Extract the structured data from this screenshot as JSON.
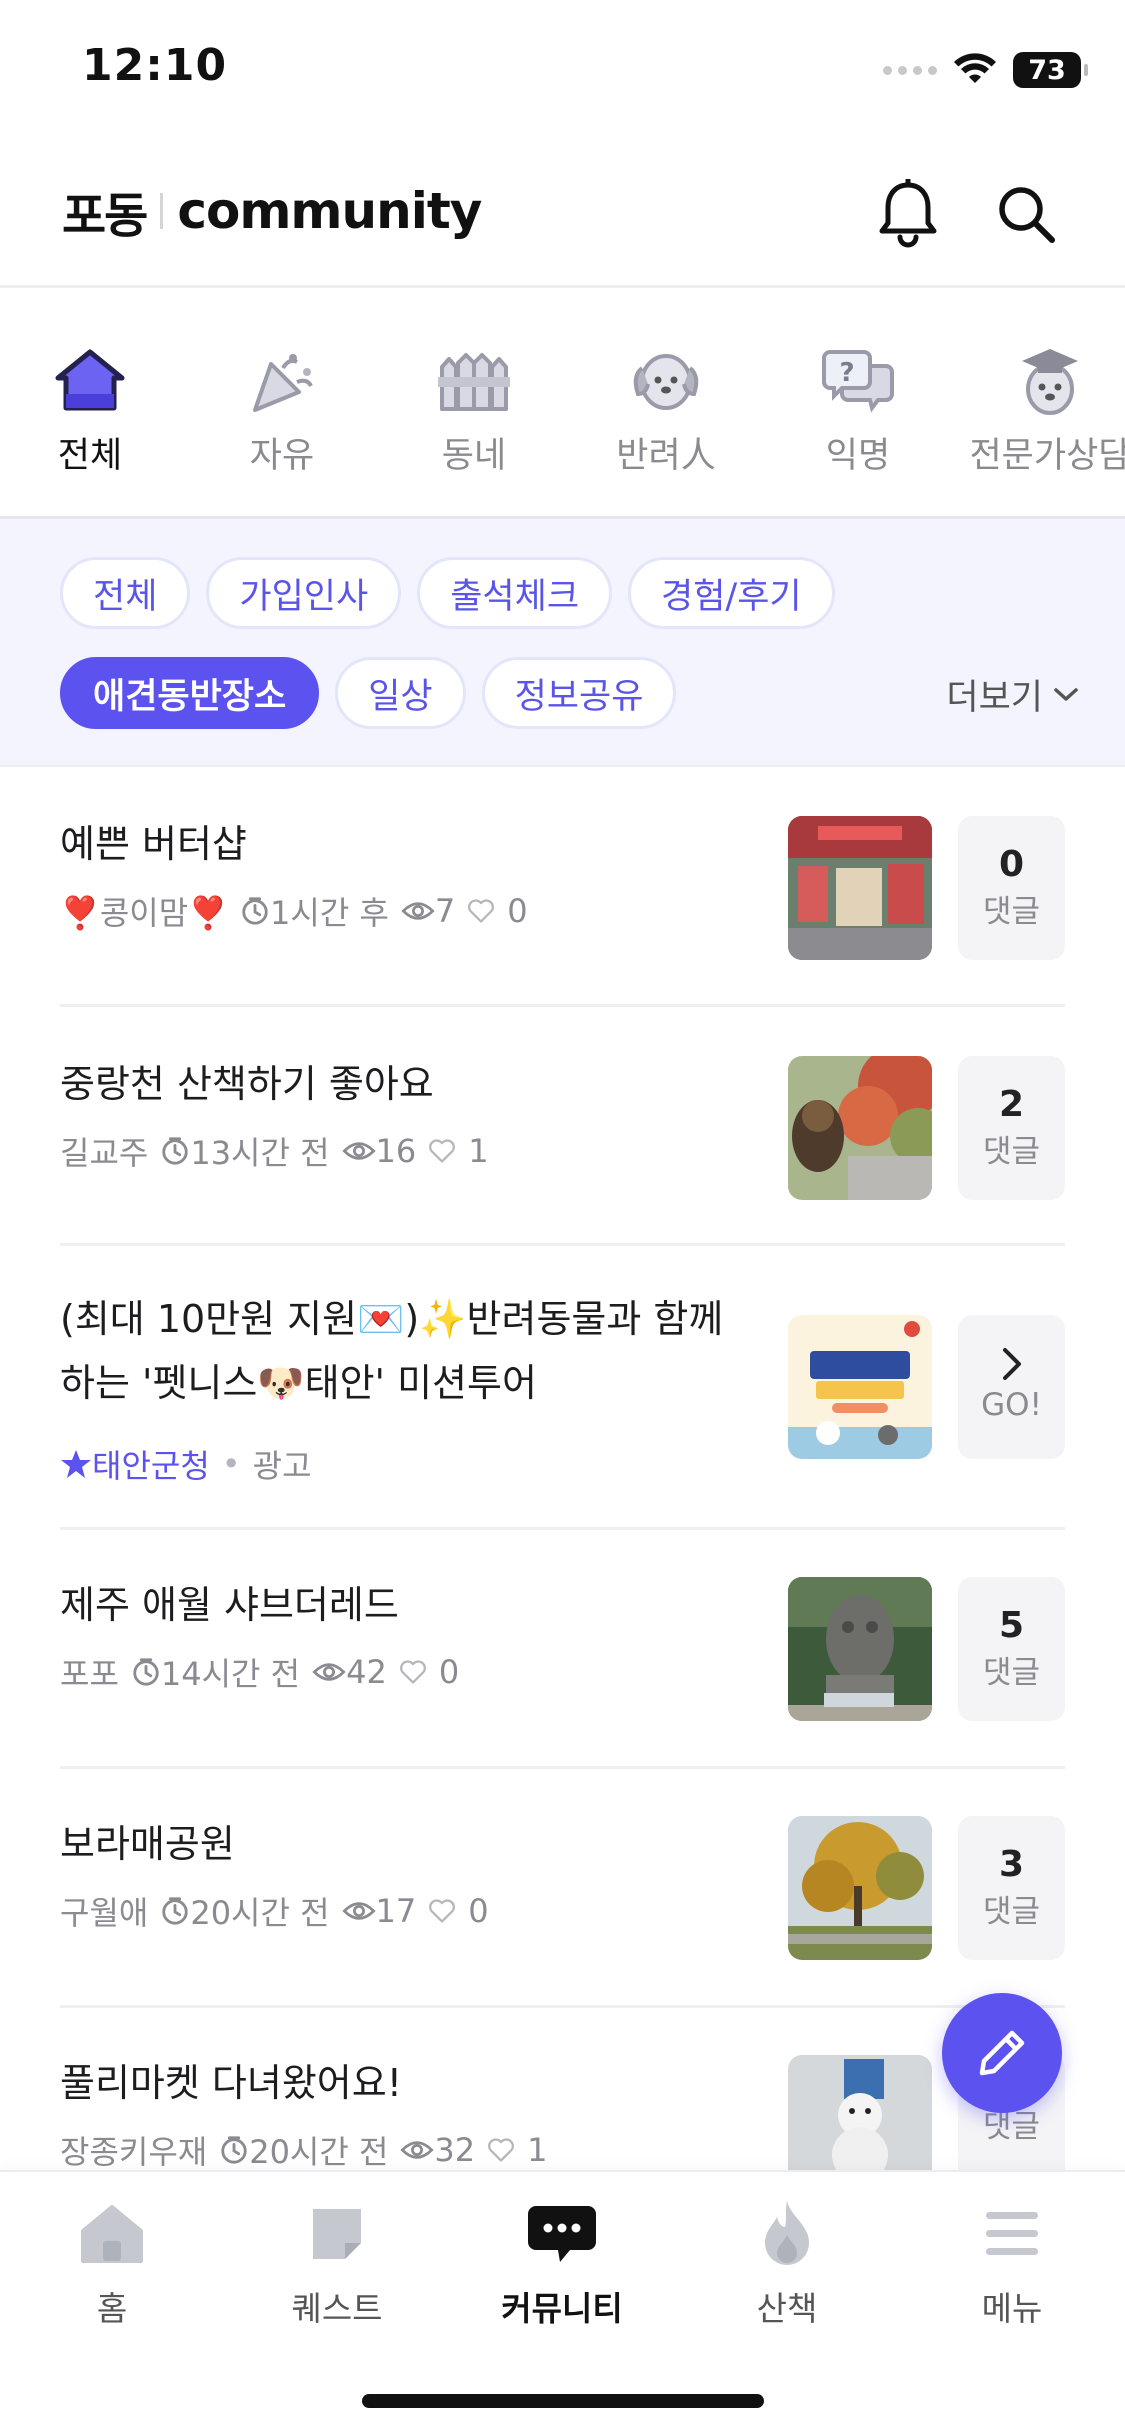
{
  "status_bar": {
    "time": "12:10",
    "battery": "73"
  },
  "header": {
    "logo_ko": "포동",
    "logo_en": "community"
  },
  "category_tabs": [
    {
      "label": "전체",
      "icon": "house-icon",
      "active": true
    },
    {
      "label": "자유",
      "icon": "party-popper-icon",
      "active": false
    },
    {
      "label": "동네",
      "icon": "fence-icon",
      "active": false
    },
    {
      "label": "반려人",
      "icon": "dog-face-icon",
      "active": false
    },
    {
      "label": "익명",
      "icon": "question-bubble-icon",
      "active": false
    },
    {
      "label": "전문가상담",
      "icon": "graduate-dog-icon",
      "active": false
    }
  ],
  "filter_chips": {
    "row1": [
      "전체",
      "가입인사",
      "출석체크",
      "경험/후기"
    ],
    "row2": [
      "애견동반장소",
      "일상",
      "정보공유"
    ],
    "active": "애견동반장소",
    "more_label": "더보기"
  },
  "posts": [
    {
      "title": "예쁜 버터샵",
      "author": "❣️콩이맘❣️",
      "time": "1시간 후",
      "views": "7",
      "likes": "0",
      "comment_count": "0",
      "comment_label": "댓글"
    },
    {
      "title": "중랑천 산책하기 좋아요",
      "author": "길교주",
      "time": "13시간 전",
      "views": "16",
      "likes": "1",
      "comment_count": "2",
      "comment_label": "댓글"
    },
    {
      "title_line1": "(최대 10만원 지원💌)✨반려동물과 함께",
      "title_line2": "하는 '펫니스🐶태안' 미션투어",
      "source": "태안군청",
      "ad_label": "광고",
      "cta_label": "GO!"
    },
    {
      "title": "제주 애월 샤브더레드",
      "author": "포포",
      "time": "14시간 전",
      "views": "42",
      "likes": "0",
      "comment_count": "5",
      "comment_label": "댓글"
    },
    {
      "title": "보라매공원",
      "author": "구월애",
      "time": "20시간 전",
      "views": "17",
      "likes": "0",
      "comment_count": "3",
      "comment_label": "댓글"
    },
    {
      "title": "풀리마켓 다녀왔어요!",
      "author": "장종키우재",
      "time": "20시간 전",
      "views": "32",
      "likes": "1",
      "comment_count": "",
      "comment_label": "댓글"
    }
  ],
  "bottom_nav": [
    {
      "label": "홈",
      "icon": "home-icon",
      "active": false
    },
    {
      "label": "퀘스트",
      "icon": "note-icon",
      "active": false
    },
    {
      "label": "커뮤니티",
      "icon": "chat-bubble-icon",
      "active": true
    },
    {
      "label": "산책",
      "icon": "flame-icon",
      "active": false
    },
    {
      "label": "메뉴",
      "icon": "hamburger-menu-icon",
      "active": false
    }
  ],
  "colors": {
    "accent": "#5b52f0",
    "chip_bg": "#f3f4fd",
    "text_muted": "#8a8a90"
  }
}
